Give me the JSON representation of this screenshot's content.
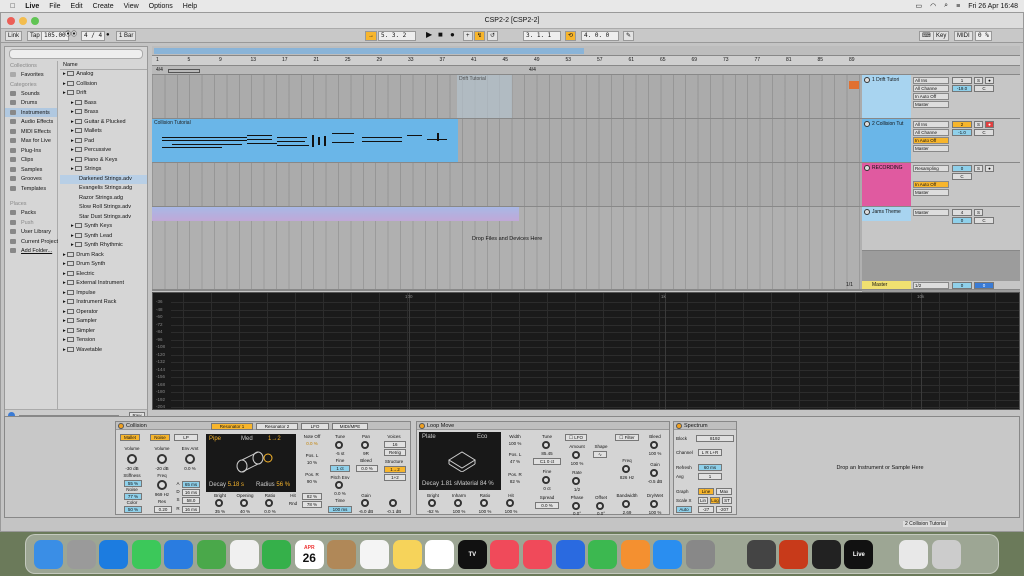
{
  "menubar": {
    "apple": "",
    "app": "Live",
    "items": [
      "File",
      "Edit",
      "Create",
      "View",
      "Options",
      "Help"
    ],
    "datetime": "Fri 26 Apr 16:48"
  },
  "window": {
    "title": "CSP2-2  [CSP2-2]"
  },
  "toolbar": {
    "link": "Link",
    "tap": "Tap",
    "tempo": "105.00",
    "sig": "4 / 4",
    "quant": "1 Bar",
    "pos": "5.  3.  2",
    "pos2": "3.  1.  1",
    "loop_len": "4.  0.  0",
    "key": "Key",
    "midi": "MIDI",
    "cpu": "0 %"
  },
  "browser": {
    "collections_header": "Collections",
    "favorites": "Favorites",
    "categories_header": "Categories",
    "categories": [
      "Sounds",
      "Drums",
      "Instruments",
      "Audio Effects",
      "MIDI Effects",
      "Max for Live",
      "Plug-Ins",
      "Clips",
      "Samples",
      "Grooves",
      "Templates"
    ],
    "places_header": "Places",
    "places": [
      "Packs",
      "Push",
      "User Library",
      "Current Project",
      "Add Folder..."
    ],
    "name_header": "Name",
    "tree": [
      [
        "Analog",
        0
      ],
      [
        "Collision",
        0
      ],
      [
        "Drift",
        0
      ],
      [
        "Bass",
        1
      ],
      [
        "Brass",
        1
      ],
      [
        "Guitar & Plucked",
        1
      ],
      [
        "Mallets",
        1
      ],
      [
        "Pad",
        1
      ],
      [
        "Percussive",
        1
      ],
      [
        "Piano & Keys",
        1
      ],
      [
        "Strings",
        1
      ],
      [
        "Darkened Strings.adv",
        2
      ],
      [
        "Evangelis Strings.adg",
        2
      ],
      [
        "Razor Strings.adg",
        2
      ],
      [
        "Slow Roll Strings.adv",
        2
      ],
      [
        "Star Dust Strings.adv",
        2
      ],
      [
        "Synth Keys",
        1
      ],
      [
        "Synth Lead",
        1
      ],
      [
        "Synth Rhythmic",
        1
      ],
      [
        "Drum Rack",
        0
      ],
      [
        "Drum Synth",
        0
      ],
      [
        "Electric",
        0
      ],
      [
        "External Instrument",
        0
      ],
      [
        "Impulse",
        0
      ],
      [
        "Instrument Rack",
        0
      ],
      [
        "Operator",
        0
      ],
      [
        "Sampler",
        0
      ],
      [
        "Simpler",
        0
      ],
      [
        "Tension",
        0
      ],
      [
        "Wavetable",
        0
      ]
    ],
    "raw": "Raw"
  },
  "arrangement": {
    "sig_start": "4/4",
    "sig_mid": "4/4",
    "bars": [
      "1",
      "5",
      "9",
      "13",
      "17",
      "21",
      "25",
      "29",
      "33",
      "37",
      "41",
      "45",
      "49",
      "53",
      "57",
      "61",
      "65",
      "69",
      "73",
      "77",
      "81",
      "85",
      "89"
    ],
    "times": [
      "0:00",
      "0:15",
      "0:30",
      "0:45",
      "1:00",
      "1:15",
      "1:30",
      "1:45",
      "2:00",
      "2:15",
      "2:30",
      "2:45",
      "3:00"
    ],
    "fraction": "1/1",
    "drop_text": "Drop Files and Devices Here",
    "tracks": [
      {
        "name": "1 Drift Tutori",
        "in": "All Ins",
        "ch": "All Channe",
        "mon": "In Auto Off",
        "out": "Master",
        "vol": "-19.0",
        "pan": "C",
        "num": "1",
        "clip": "Drift Tutorial",
        "color": "#a8d4f0"
      },
      {
        "name": "2 Collision Tut",
        "in": "All Ins",
        "ch": "All Channe",
        "mon": "In Auto Off",
        "out": "Master",
        "vol": "-1.0",
        "pan": "C",
        "num": "2",
        "clip": "Collision Tutorial",
        "color": "#6ab6e8"
      },
      {
        "name": "RECORDING",
        "in": "Resampling",
        "ch": "",
        "mon": "In Auto Off",
        "out": "Master",
        "vol": "0",
        "pan": "C",
        "num": "3",
        "clip": "",
        "color": "#e05aa0"
      },
      {
        "name": "Jams Theme",
        "in": "Master",
        "ch": "",
        "mon": "",
        "out": "",
        "vol": "0",
        "pan": "C",
        "num": "4",
        "clip": "",
        "color": "#a8d4f0"
      }
    ],
    "master": {
      "name": "Master",
      "out": "1/2",
      "vol": "0",
      "pan": "0"
    }
  },
  "detail": {
    "ylabels": [
      "-36",
      "-48",
      "-60",
      "-72",
      "-84",
      "-96",
      "-108",
      "-120",
      "-132",
      "-144",
      "-156",
      "-168",
      "-180",
      "-192",
      "-204"
    ],
    "xlabels": [
      "100",
      "1k",
      "10k"
    ]
  },
  "devices": {
    "collision": {
      "title": "Collision",
      "mallet": "Mallet",
      "noise": "Noise",
      "lp": "LP",
      "volume": "Volume",
      "vol_val": "-30 dB",
      "stiffness": "Stiffness",
      "stiff_val": "55 %",
      "noise_l": "Noise",
      "noise_val": "77 %",
      "color": "Color",
      "color_val": "50 %",
      "vol2": "Volume",
      "vol2_val": "-20 dB",
      "freq": "Freq",
      "freq_val": "969 Hz",
      "res": "Res",
      "res_val": "0.20",
      "env": "Env Amt",
      "env_val": "0.0 %",
      "a": "A",
      "a_val": "65 ms",
      "d": "D",
      "d_val": "16 ms",
      "s": "S",
      "s_val": "58.0",
      "r": "R",
      "r_val": "16 ms"
    },
    "resonator": {
      "tab1": "Resonator 1",
      "tab2": "Resonator 2",
      "lfo": "LFO",
      "mpe": "MIDI/MPE",
      "type": "Pipe",
      "quality": "Med",
      "ratio": "1→2",
      "decay": "Decay",
      "decay_val": "5.18 s",
      "radius": "Radius",
      "radius_val": "56 %",
      "noteoff": "Note Off",
      "noteoff_val": "0.0 %",
      "posl": "Pos. L",
      "posl_val": "10 %",
      "posr": "Pos. R",
      "posr_val": "90 %",
      "hit": "Hit",
      "hit_val": "82 %",
      "rnd": "Rnd",
      "rnd_val": "78 %",
      "bright": "Bright",
      "bright_val": "35 %",
      "opening": "Opening",
      "open_val": "40 %",
      "ratio2": "Ratio",
      "ratio_val": "0.0 %",
      "tune": "Tune",
      "tune_val": "-5 st",
      "fine": "Fine",
      "fine_val": "1 ct",
      "pitchenv": "Pitch Env",
      "pe_val": "0.0 %",
      "time": "Time",
      "time_val": "100 ms",
      "pan": "Pan",
      "pan_val": "9R",
      "bleed": "Bleed",
      "bleed_val": "0.0 %",
      "gain": "Gain",
      "gain_val": "-6.0 dB",
      "voices": "Voices",
      "voices_val": "16",
      "retrig": "Retrig",
      "structure": "Structure",
      "struct1": "1→2",
      "struct2": "1+2",
      "out_val": "-0.1 dB"
    },
    "loopmove": {
      "title": "Loop Move",
      "plate": "Plate",
      "type": "Eco",
      "width": "Width",
      "width_val": "100 %",
      "posl": "Pos. L",
      "posl_val": "47 %",
      "posr": "Pos. R",
      "posr_val": "82 %",
      "decay": "Decay",
      "decay_val": "1.81 s",
      "material": "Material",
      "mat_val": "84 %",
      "bright": "Bright",
      "bright_val": "-62 %",
      "inharm": "Inharm",
      "inharm_val": "100 %",
      "ratio": "Ratio",
      "ratio_val": "100 %",
      "hit": "Hit",
      "hit_val": "100 %",
      "tune": "Tune",
      "tune_val": "85.45",
      "note": "C1  0 ct",
      "fine": "Fine",
      "fine_val": "0 ct",
      "spread": "Spread",
      "spread_val": "0.0 %",
      "lfo": "LFO",
      "amount": "Amount",
      "amount_val": "100 %",
      "shape": "Shape",
      "rate": "Rate",
      "rate_val": "1/2",
      "phase": "Phase",
      "phase_val": "0.0°",
      "offset": "Offset",
      "offset_val": "0.0°",
      "filter": "Filter",
      "freq": "Freq",
      "freq_val": "826 Hz",
      "bw": "Bandwidth",
      "bw_val": "2.69",
      "bleed": "Bleed",
      "bleed_val": "100 %",
      "gain": "Gain",
      "gain_val": "-0.5 dB",
      "drywet": "Dry/Wet",
      "dw_val": "100 %"
    },
    "spectrum": {
      "title": "Spectrum",
      "block": "Block",
      "block_val": "8192",
      "channel": "Channel",
      "lr": "L R L+R",
      "refresh": "Refresh",
      "refresh_val": "60 ms",
      "avg": "Avg",
      "avg_val": "1",
      "graph": "Graph",
      "line": "Line",
      "max": "Max",
      "scalex": "Scale X",
      "lin": "Lin",
      "log": "Log",
      "st": "ST",
      "auto": "Auto",
      "rmin": "-27",
      "rmax": "-207"
    },
    "drop": "Drop an Instrument or Sample Here",
    "footer": "2 Collision Tutorial"
  },
  "dock": [
    "Finder",
    "Launchpad",
    "Safari",
    "Messages",
    "Mail",
    "Maps",
    "Photos",
    "FaceTime",
    "26",
    "Contacts",
    "Reminders",
    "Notes",
    "Freeform",
    "TV",
    "Music",
    "News",
    "Keynote",
    "Numbers",
    "Pages",
    "App Store",
    "System Settings",
    "Logic",
    "PowerPoint",
    "Piano",
    "Live",
    "Preview",
    "Trash"
  ],
  "dock_date": {
    "month": "APR",
    "day": "26"
  }
}
